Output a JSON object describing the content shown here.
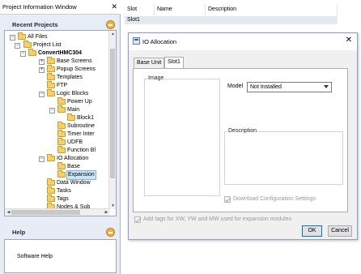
{
  "project_window": {
    "title": "Project Information Window",
    "recent_projects_title": "Recent Projects",
    "help_title": "Help",
    "help_text": "Software Help",
    "tree": [
      {
        "label": "All Files"
      },
      {
        "label": "Project List"
      },
      {
        "label": "ConvertHMC304"
      },
      {
        "label": "Base Screens"
      },
      {
        "label": "Popup Screens"
      },
      {
        "label": "Templates"
      },
      {
        "label": "FTP"
      },
      {
        "label": "Logic Blocks"
      },
      {
        "label": "Power Up"
      },
      {
        "label": "Main"
      },
      {
        "label": "Block1"
      },
      {
        "label": "Subroutine"
      },
      {
        "label": "Timer Inter"
      },
      {
        "label": "UDFB"
      },
      {
        "label": "Function Bl"
      },
      {
        "label": "IO Allocation"
      },
      {
        "label": "Base"
      },
      {
        "label": "Expansion"
      },
      {
        "label": "Data Window"
      },
      {
        "label": "Tasks"
      },
      {
        "label": "Tags"
      },
      {
        "label": "Nodes & Sub"
      }
    ]
  },
  "slot_table": {
    "headers": [
      "Slot",
      "Name",
      "Description"
    ],
    "rows": [
      [
        "Slot1",
        "",
        ""
      ]
    ]
  },
  "dialog": {
    "title": "IO Allocation",
    "tabs": [
      "Base Unit",
      "Slot1"
    ],
    "active_tab": "Slot1",
    "image_label": "Image",
    "model_label": "Model",
    "model_value": "Not Installed",
    "description_label": "Description",
    "download_config_label": "Download Configuration Settings",
    "download_config_checked": true,
    "add_tags_label": "Add tags for XW, YW and MW used for expansion  modules",
    "add_tags_checked": true,
    "ok_label": "OK",
    "cancel_label": "Cancel"
  },
  "colors": {
    "accent_orange": "#f3b24a",
    "selection": "#cde3f7",
    "folder": "#f5d06a"
  }
}
